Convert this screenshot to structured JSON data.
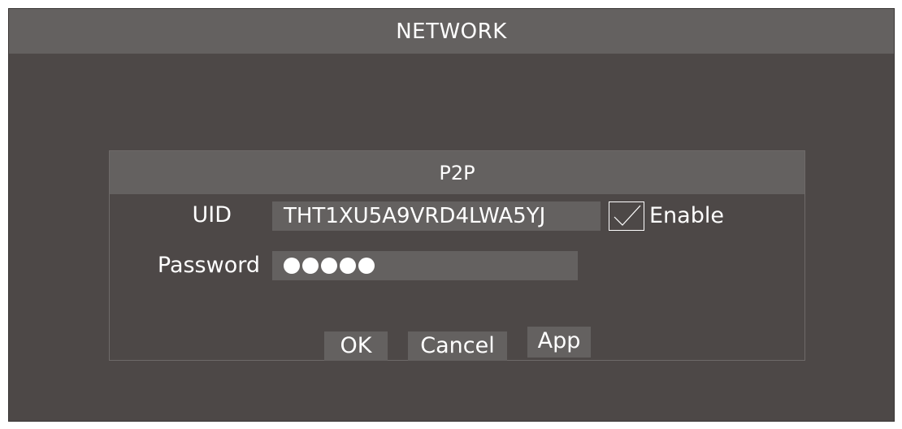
{
  "window": {
    "title": "NETWORK"
  },
  "dialog": {
    "title": "P2P",
    "uid_label": "UID",
    "uid_value": "THT1XU5A9VRD4LWA5YJ",
    "enable_label": "Enable",
    "enable_checked": true,
    "password_label": "Password",
    "password_mask_count": 5,
    "buttons": {
      "ok": "OK",
      "cancel": "Cancel",
      "app": "App"
    }
  },
  "colors": {
    "background": "#4d4847",
    "bar": "#646160",
    "text": "#ffffff"
  }
}
